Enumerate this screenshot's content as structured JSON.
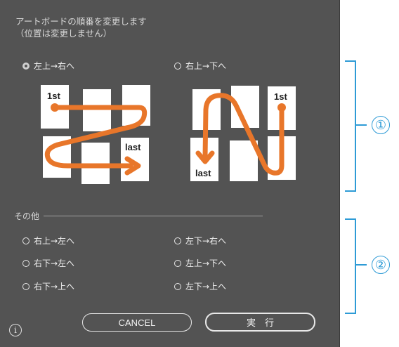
{
  "description": {
    "line1": "アートボードの順番を変更します",
    "line2": "（位置は変更しません）"
  },
  "main_options": [
    {
      "label": "左上→右へ",
      "selected": true
    },
    {
      "label": "右上→下へ",
      "selected": false
    }
  ],
  "diagram_labels": {
    "first": "1st",
    "last": "last"
  },
  "other_section": {
    "title": "その他",
    "options": [
      {
        "label": "右上→左へ",
        "selected": false
      },
      {
        "label": "左下→右へ",
        "selected": false
      },
      {
        "label": "右下→左へ",
        "selected": false
      },
      {
        "label": "左上→下へ",
        "selected": false
      },
      {
        "label": "右下→上へ",
        "selected": false
      },
      {
        "label": "左下→上へ",
        "selected": false
      }
    ]
  },
  "buttons": {
    "cancel": "CANCEL",
    "execute": "実　行"
  },
  "info_icon": "i",
  "annotations": {
    "one": "①",
    "two": "②"
  },
  "colors": {
    "panel_bg": "#535353",
    "arrow": "#e8762a",
    "annotation": "#2e9bd6"
  }
}
